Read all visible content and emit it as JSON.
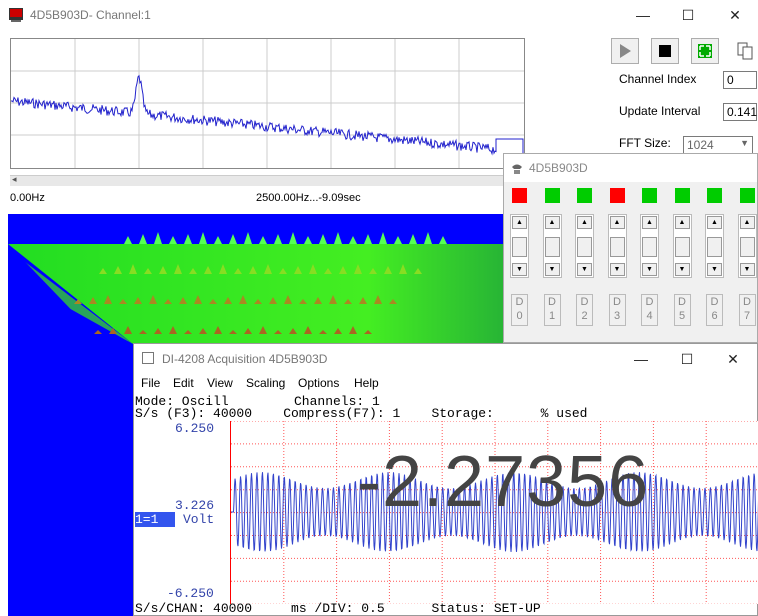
{
  "main_window": {
    "title": "4D5B903D- Channel:1",
    "minimize": "—",
    "maximize": "☐",
    "close": "✕"
  },
  "spectrum": {
    "left_label": "0.00Hz",
    "center_label": "2500.00Hz...-9.09sec"
  },
  "controls": {
    "channel_index_label": "Channel Index",
    "channel_index_value": "0",
    "update_interval_label": "Update Interval",
    "update_interval_value": "0.141",
    "fft_size_label": "FFT Size:",
    "fft_size_value": "1024"
  },
  "dio_window": {
    "title": "4D5B903D",
    "leds": [
      "red",
      "green",
      "green",
      "red",
      "green",
      "green",
      "green",
      "green"
    ],
    "buttons": [
      "D\n0",
      "D\n1",
      "D\n2",
      "D\n3",
      "D\n4",
      "D\n5",
      "D\n6",
      "D\n7"
    ]
  },
  "acq_window": {
    "title": "DI-4208 Acquisition 4D5B903D",
    "menu": [
      "File",
      "Edit",
      "View",
      "Scaling",
      "Options",
      "Help"
    ],
    "line1_left": "Mode: Oscill",
    "line1_right": "Channels: 1",
    "line2": "S/s (F3): 40000    Compress(F7): 1    Storage:      % used",
    "y_top": "6.250",
    "y_mid": "3.226",
    "y_bottom": "-6.250",
    "channel_label": "1=1",
    "unit": "Volt",
    "readout": "-2.27356",
    "status_line": "S/s/CHAN: 40000     ms /DIV: 0.5      Status: SET-UP"
  },
  "colors": {
    "led_red": "#ff0000",
    "led_green": "#00cc00",
    "trace": "#2222cc",
    "grid": "#ff4444"
  }
}
